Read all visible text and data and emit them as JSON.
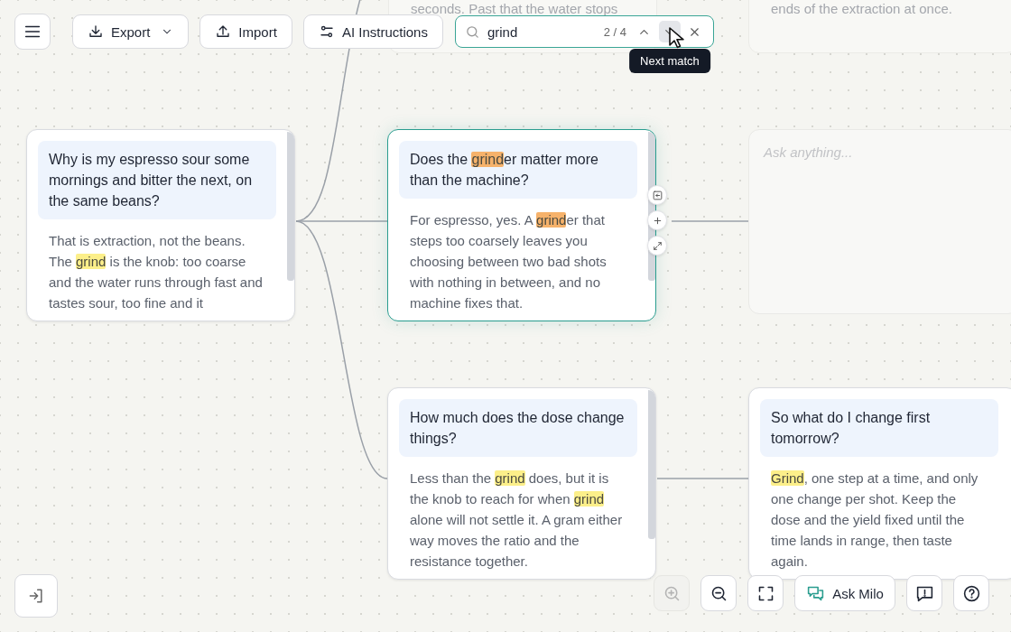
{
  "toolbar": {
    "buttons": [
      {
        "kind": "export",
        "label": "Export",
        "dropdown": true
      },
      {
        "kind": "import",
        "label": "Import",
        "dropdown": false
      },
      {
        "kind": "instructions",
        "label": "AI Instructions",
        "dropdown": false
      }
    ]
  },
  "search": {
    "value": "grind",
    "count": "2 / 4",
    "nav": [
      {
        "kind": "prev",
        "hovered": false
      },
      {
        "kind": "next",
        "hovered": true
      }
    ],
    "tooltip": "Next match"
  },
  "nodes": [
    {
      "kind": "fragment",
      "text": "seconds. Past that the water stops"
    },
    {
      "kind": "fragment",
      "text": "ends of the extraction at once."
    },
    {
      "kind": "qa",
      "selected": false,
      "scrollable": true,
      "question": [
        {
          "kind": "text",
          "text": "Why is my espresso sour some mornings and bitter the next, on the same beans?"
        }
      ],
      "answer": [
        {
          "kind": "text",
          "text": "That is extraction, not the beans. The "
        },
        {
          "kind": "match",
          "text": "grind"
        },
        {
          "kind": "text",
          "text": " is the knob: too coarse and the water runs through fast and tastes sour, too fine and it"
        }
      ]
    },
    {
      "kind": "qa",
      "selected": true,
      "scrollable": true,
      "question": [
        {
          "kind": "text",
          "text": "Does the "
        },
        {
          "kind": "current",
          "text": "grind"
        },
        {
          "kind": "text",
          "text": "er matter more than the machine?"
        }
      ],
      "answer": [
        {
          "kind": "text",
          "text": "For espresso, yes. A "
        },
        {
          "kind": "current",
          "text": "grind"
        },
        {
          "kind": "text",
          "text": "er that steps too coarsely leaves you choosing between two bad shots with nothing in between, and no machine fixes that."
        }
      ]
    },
    {
      "kind": "empty",
      "placeholder": "Ask anything..."
    },
    {
      "kind": "qa",
      "selected": false,
      "scrollable": true,
      "question": [
        {
          "kind": "text",
          "text": "How much does the dose change things?"
        }
      ],
      "answer": [
        {
          "kind": "text",
          "text": "Less than the "
        },
        {
          "kind": "match",
          "text": "grind"
        },
        {
          "kind": "text",
          "text": " does, but it is the knob to reach for when "
        },
        {
          "kind": "match",
          "text": "grind"
        },
        {
          "kind": "text",
          "text": " alone will not settle it. A gram either way moves the ratio and the resistance together."
        }
      ]
    },
    {
      "kind": "qa",
      "selected": false,
      "scrollable": false,
      "question": [
        {
          "kind": "text",
          "text": "So what do I change first tomorrow?"
        }
      ],
      "answer": [
        {
          "kind": "match",
          "text": "Grind"
        },
        {
          "kind": "text",
          "text": ", one step at a time, and only one change per shot. Keep the dose and the yield fixed until the time lands in range, then taste again."
        }
      ]
    }
  ],
  "bottom_bar": {
    "buttons": [
      {
        "kind": "zoom-in",
        "disabled": true
      },
      {
        "kind": "zoom-out",
        "disabled": false
      },
      {
        "kind": "fit",
        "disabled": false
      },
      {
        "kind": "ask",
        "label": "Ask Milo",
        "disabled": false
      },
      {
        "kind": "feedback",
        "disabled": false
      },
      {
        "kind": "help",
        "disabled": false
      }
    ]
  }
}
